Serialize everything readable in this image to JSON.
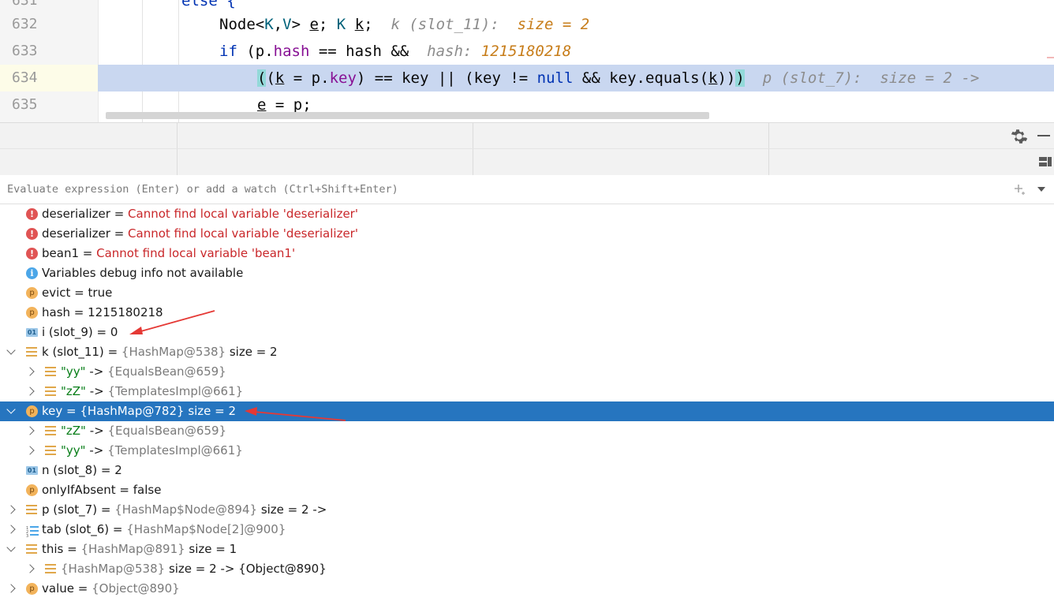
{
  "editor": {
    "lines": [
      {
        "num": "631",
        "parts": [
          {
            "t": "else {",
            "c": "kw"
          }
        ]
      },
      {
        "num": "632",
        "parts": [
          {
            "t": "Node<",
            "c": ""
          },
          {
            "t": "K",
            "c": "tp"
          },
          {
            "t": ",",
            "c": ""
          },
          {
            "t": "V",
            "c": "tp"
          },
          {
            "t": "> ",
            "c": ""
          },
          {
            "t": "e",
            "c": "ul"
          },
          {
            "t": "; ",
            "c": ""
          },
          {
            "t": "K",
            "c": "tp"
          },
          {
            "t": " ",
            "c": ""
          },
          {
            "t": "k",
            "c": "ul"
          },
          {
            "t": ";  ",
            "c": ""
          },
          {
            "t": "k (slot_11):  ",
            "c": "hint"
          },
          {
            "t": "size = 2",
            "c": "hintv"
          }
        ]
      },
      {
        "num": "633",
        "parts": [
          {
            "t": "if",
            "c": "kw"
          },
          {
            "t": " (p.",
            "c": ""
          },
          {
            "t": "hash",
            "c": "fld"
          },
          {
            "t": " == hash &&  ",
            "c": ""
          },
          {
            "t": "hash: ",
            "c": "hint"
          },
          {
            "t": "1215180218",
            "c": "hintv"
          }
        ]
      },
      {
        "num": "634",
        "parts": [
          {
            "t": "(",
            "c": "bracket-hl"
          },
          {
            "t": "(",
            "c": ""
          },
          {
            "t": "k",
            "c": "ul"
          },
          {
            "t": " = p.",
            "c": ""
          },
          {
            "t": "key",
            "c": "fld"
          },
          {
            "t": ") == key || (key != ",
            "c": ""
          },
          {
            "t": "null",
            "c": "kw"
          },
          {
            "t": " && key.equals(",
            "c": ""
          },
          {
            "t": "k",
            "c": "ul"
          },
          {
            "t": "))",
            "c": ""
          },
          {
            "t": ")",
            "c": "bracket-hl"
          },
          {
            "t": "  ",
            "c": ""
          },
          {
            "t": "p (slot_7):  size = 2 ->",
            "c": "hint"
          }
        ]
      },
      {
        "num": "635",
        "parts": [
          {
            "t": "e",
            "c": "ul"
          },
          {
            "t": " = p;",
            "c": ""
          }
        ]
      }
    ]
  },
  "evaluate": {
    "placeholder": "Evaluate expression (Enter) or add a watch (Ctrl+Shift+Enter)"
  },
  "variables": [
    {
      "icon": "error",
      "name": "deserializer",
      "sep": " = ",
      "value": "Cannot find local variable 'deserializer'",
      "vclass": "errt",
      "expander": ""
    },
    {
      "icon": "error",
      "name": "deserializer",
      "sep": " = ",
      "value": "Cannot find local variable 'deserializer'",
      "vclass": "errt",
      "expander": ""
    },
    {
      "icon": "error",
      "name": "bean1",
      "sep": " = ",
      "value": "Cannot find local variable 'bean1'",
      "vclass": "errt",
      "expander": ""
    },
    {
      "icon": "info",
      "name": "Variables debug info not available",
      "sep": "",
      "value": "",
      "vclass": "",
      "expander": ""
    },
    {
      "icon": "p",
      "name": "evict",
      "sep": " = ",
      "value": "true",
      "vclass": "",
      "expander": ""
    },
    {
      "icon": "p",
      "name": "hash",
      "sep": " = ",
      "value": "1215180218",
      "vclass": "",
      "expander": ""
    },
    {
      "icon": "01",
      "name": "i (slot_9)",
      "sep": " = ",
      "value": "0",
      "vclass": "",
      "expander": ""
    },
    {
      "icon": "list",
      "name": "k (slot_11)",
      "sep": " = ",
      "value": "{HashMap@538}",
      "vclass": "gray",
      "extra": "  size = 2",
      "expander": "open"
    },
    {
      "icon": "list",
      "indent": 1,
      "name": "\"yy\"",
      "nclass": "strv",
      "sep": " -> ",
      "value": "{EqualsBean@659}",
      "vclass": "gray",
      "expander": "closed"
    },
    {
      "icon": "list",
      "indent": 1,
      "name": "\"zZ\"",
      "nclass": "strv",
      "sep": " -> ",
      "value": "{TemplatesImpl@661}",
      "vclass": "gray",
      "expander": "closed"
    },
    {
      "icon": "p",
      "name": "key",
      "sep": " = ",
      "value": "{HashMap@782}",
      "vclass": "gray",
      "extra": "  size = 2",
      "expander": "open",
      "selected": true
    },
    {
      "icon": "list",
      "indent": 1,
      "name": "\"zZ\"",
      "nclass": "strv",
      "sep": " -> ",
      "value": "{EqualsBean@659}",
      "vclass": "gray",
      "expander": "closed"
    },
    {
      "icon": "list",
      "indent": 1,
      "name": "\"yy\"",
      "nclass": "strv",
      "sep": " -> ",
      "value": "{TemplatesImpl@661}",
      "vclass": "gray",
      "expander": "closed"
    },
    {
      "icon": "01",
      "name": "n (slot_8)",
      "sep": " = ",
      "value": "2",
      "vclass": "",
      "expander": ""
    },
    {
      "icon": "p",
      "name": "onlyIfAbsent",
      "sep": " = ",
      "value": "false",
      "vclass": "",
      "expander": ""
    },
    {
      "icon": "list",
      "name": "p (slot_7)",
      "sep": " = ",
      "value": "{HashMap$Node@894}",
      "vclass": "gray",
      "extra": "  size = 2 ->",
      "expander": "closed"
    },
    {
      "icon": "array",
      "name": "tab (slot_6)",
      "sep": " = ",
      "value": "{HashMap$Node[2]@900}",
      "vclass": "gray",
      "expander": "closed"
    },
    {
      "icon": "list",
      "name": "this",
      "sep": " = ",
      "value": "{HashMap@891}",
      "vclass": "gray",
      "extra": "  size = 1",
      "expander": "open"
    },
    {
      "icon": "list",
      "indent": 1,
      "name": "{HashMap@538}",
      "nclass": "gray",
      "sep": "",
      "value": "",
      "vclass": "",
      "extra": "  size = 2 -> {Object@890}",
      "expander": "closed"
    },
    {
      "icon": "p",
      "name": "value",
      "sep": " = ",
      "value": "{Object@890}",
      "vclass": "gray",
      "expander": "closed"
    }
  ],
  "colors": {
    "selection": "#2675bf",
    "current_line": "#c9d7f0",
    "annotation_arrow": "#e53935"
  }
}
